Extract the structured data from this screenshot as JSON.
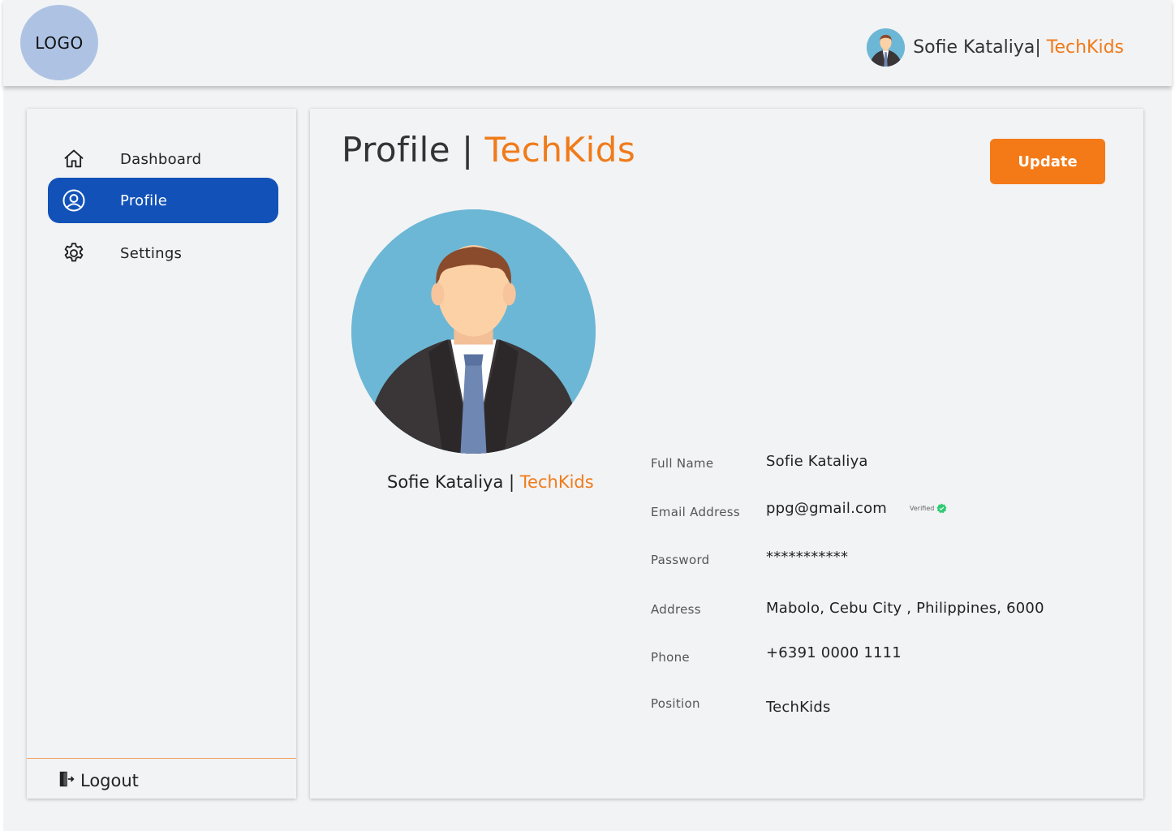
{
  "header": {
    "logo_text": "LOGO",
    "user_name": "Sofie Kataliya|",
    "user_org": " TechKids"
  },
  "sidebar": {
    "items": [
      {
        "label": "Dashboard",
        "icon": "home-icon",
        "active": false
      },
      {
        "label": "Profile",
        "icon": "user-circle-icon",
        "active": true
      },
      {
        "label": "Settings",
        "icon": "gear-icon",
        "active": false
      }
    ],
    "logout_label": "Logout"
  },
  "main": {
    "title": "Profile | ",
    "title_accent": "TechKids",
    "update_label": "Update",
    "profile_name": "Sofie Kataliya",
    "profile_sep": " | ",
    "profile_org": "TechKids",
    "fields": [
      {
        "label": "Full Name",
        "value": "Sofie Kataliya"
      },
      {
        "label": "Email Address",
        "value": "ppg@gmail.com"
      },
      {
        "label": "Password",
        "value": "***********"
      },
      {
        "label": "Address",
        "value": "Mabolo, Cebu City , Philippines, 6000"
      },
      {
        "label": "Phone",
        "value": "+6391 0000 1111"
      },
      {
        "label": "Position",
        "value": "TechKids"
      }
    ],
    "verified_label": "Verified"
  },
  "colors": {
    "accent": "#f07b1a",
    "active_nav": "#1252b8",
    "update_button": "#f47a17",
    "verified": "#2ecc71",
    "avatar_bg": "#6cb7d5"
  }
}
